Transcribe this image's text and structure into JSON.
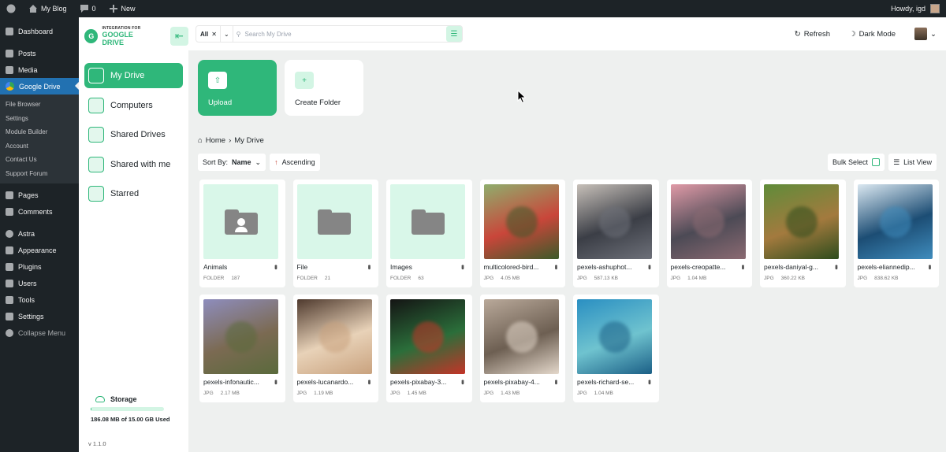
{
  "adminbar": {
    "site_name": "My Blog",
    "comments_count": "0",
    "new_label": "New",
    "greeting": "Howdy, igd"
  },
  "wp_menu": {
    "items_top": [
      "Dashboard",
      "Posts",
      "Media",
      "Google Drive"
    ],
    "submenu": [
      "File Browser",
      "Settings",
      "Module Builder",
      "Account",
      "Contact Us",
      "Support Forum"
    ],
    "items_bottom": [
      "Pages",
      "Comments",
      "Astra",
      "Appearance",
      "Plugins",
      "Users",
      "Tools",
      "Settings",
      "Collapse Menu"
    ]
  },
  "plugin": {
    "logo_small": "INTEGRATION FOR",
    "logo_big": "GOOGLE DRIVE",
    "nav": [
      {
        "label": "My Drive",
        "active": true
      },
      {
        "label": "Computers",
        "active": false
      },
      {
        "label": "Shared Drives",
        "active": false
      },
      {
        "label": "Shared with me",
        "active": false
      },
      {
        "label": "Starred",
        "active": false
      }
    ],
    "storage": {
      "title": "Storage",
      "used_text": "186.08 MB of 15.00 GB Used",
      "used_fraction": 0.012
    },
    "version": "v 1.1.0"
  },
  "header": {
    "filter_value": "All",
    "search_placeholder": "Search My Drive",
    "refresh_label": "Refresh",
    "darkmode_label": "Dark Mode"
  },
  "actions": {
    "upload_label": "Upload",
    "create_folder_label": "Create Folder"
  },
  "breadcrumb": {
    "home": "Home",
    "current": "My Drive"
  },
  "toolbar": {
    "sort_prefix": "Sort By:",
    "sort_value": "Name",
    "order_label": "Ascending",
    "bulk_select_label": "Bulk Select",
    "view_label": "List View"
  },
  "files": [
    {
      "name": "Animals",
      "type": "FOLDER",
      "meta": "187",
      "kind": "folder",
      "icon": "person"
    },
    {
      "name": "File",
      "type": "FOLDER",
      "meta": "21",
      "kind": "folder",
      "icon": "plain"
    },
    {
      "name": "Images",
      "type": "FOLDER",
      "meta": "63",
      "kind": "folder",
      "icon": "plain"
    },
    {
      "name": "multicolored-bird...",
      "type": "JPG",
      "meta": "4.05 MB",
      "kind": "image",
      "colors": [
        "#8fae6d",
        "#3c5a2a",
        "#c9463a"
      ]
    },
    {
      "name": "pexels-ashuphot...",
      "type": "JPG",
      "meta": "587.13 KB",
      "kind": "image",
      "colors": [
        "#c7c0b9",
        "#6d7079",
        "#3b3e46"
      ]
    },
    {
      "name": "pexels-creopatte...",
      "type": "JPG",
      "meta": "1.04 MB",
      "kind": "image",
      "colors": [
        "#e09aa7",
        "#8b6a72",
        "#4c4a55"
      ]
    },
    {
      "name": "pexels-daniyal-g...",
      "type": "JPG",
      "meta": "360.22 KB",
      "kind": "image",
      "colors": [
        "#5f8c3a",
        "#2d4c1c",
        "#a37a3e"
      ]
    },
    {
      "name": "pexels-eliannedip...",
      "type": "JPG",
      "meta": "838.62 KB",
      "kind": "image",
      "colors": [
        "#dbe8f1",
        "#3f8cbd",
        "#1c4d74"
      ]
    },
    {
      "name": "pexels-infonautic...",
      "type": "JPG",
      "meta": "2.17 MB",
      "kind": "image",
      "colors": [
        "#8e8dbd",
        "#5a6a3c",
        "#7b6a52"
      ]
    },
    {
      "name": "pexels-lucanardo...",
      "type": "JPG",
      "meta": "1.19 MB",
      "kind": "image",
      "colors": [
        "#4f3a2e",
        "#c9a27e",
        "#e8d2b8"
      ]
    },
    {
      "name": "pexels-pixabay-3...",
      "type": "JPG",
      "meta": "1.45 MB",
      "kind": "image",
      "colors": [
        "#141414",
        "#c43428",
        "#2b6e3a"
      ]
    },
    {
      "name": "pexels-pixabay-4...",
      "type": "JPG",
      "meta": "1.43 MB",
      "kind": "image",
      "colors": [
        "#b9a99a",
        "#e4d8cb",
        "#6d5f52"
      ]
    },
    {
      "name": "pexels-richard-se...",
      "type": "JPG",
      "meta": "1.04 MB",
      "kind": "image",
      "colors": [
        "#2a8fc2",
        "#1b5f86",
        "#6fc3cf"
      ]
    }
  ]
}
